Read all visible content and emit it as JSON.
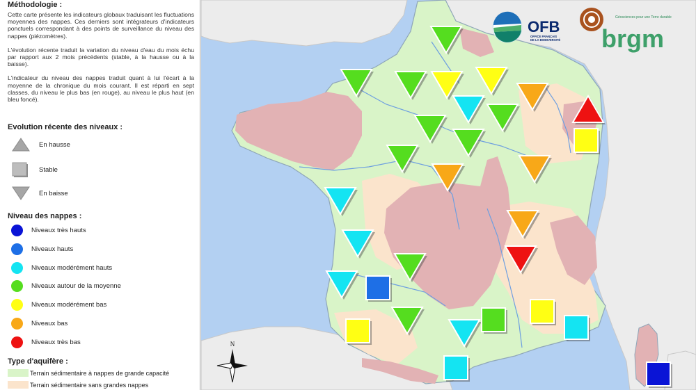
{
  "legend": {
    "methodology_title": "Méthodologie :",
    "methodology_p1": "Cette carte présente les indicateurs globaux traduisant les fluctuations moyennes des nappes. Ces derniers sont intégrateurs d'indicateurs ponctuels correspondant à des points de surveillance du niveau des nappes (piézomètres).",
    "methodology_p2": "L'évolution récente traduit la variation du niveau d'eau du mois échu par rapport aux 2 mois précédents (stable, à la hausse ou à la baisse).",
    "methodology_p3": "L'indicateur du niveau des nappes traduit quant à lui l'écart à la moyenne de la chronique du mois courant. Il est réparti en sept classes, du niveau le plus bas (en rouge), au niveau le plus haut (en bleu foncé).",
    "evolution_title": "Evolution récente des niveaux :",
    "evolution_items": [
      "En hausse",
      "Stable",
      "En baisse"
    ],
    "niveau_title": "Niveau des nappes :",
    "niveau_items": [
      {
        "label": "Niveaux très hauts",
        "color": "#0a14d6"
      },
      {
        "label": "Niveaux hauts",
        "color": "#1e6fe6"
      },
      {
        "label": "Niveaux modérément hauts",
        "color": "#14e4f2"
      },
      {
        "label": "Niveaux autour de la moyenne",
        "color": "#55dd1f"
      },
      {
        "label": "Niveaux modérément bas",
        "color": "#ffff14"
      },
      {
        "label": "Niveaux bas",
        "color": "#f8a818"
      },
      {
        "label": "Niveaux très bas",
        "color": "#ee1212"
      }
    ],
    "aquifere_title": "Type d'aquifère :",
    "aquifere_items": [
      {
        "label": "Terrain sédimentaire à nappes de grande capacité",
        "color": "#d9f4c8"
      },
      {
        "label": "Terrain sédimentaire sans grandes nappes",
        "color": "#fbe4cc"
      }
    ]
  },
  "logos": {
    "ofb": "OFB",
    "ofb_sub_1": "OFFICE FRANÇAIS",
    "ofb_sub_2": "DE LA BIODIVERSITÉ",
    "brgm": "brgm",
    "brgm_tagline": "Géosciences pour une Terre durable"
  },
  "compass_label": "N",
  "colors": {
    "sea": "#b3d0f2",
    "land_outside": "#ececec",
    "sedimentary": "#d9f4c8",
    "sedimentary_no_aquifer": "#fbe4cc",
    "basement": "#e2b2b4",
    "river": "#6e9fe0"
  },
  "indicators": [
    {
      "level": "moyenne",
      "trend": "baisse"
    },
    {
      "level": "moyenne",
      "trend": "baisse"
    },
    {
      "level": "moyenne",
      "trend": "baisse"
    },
    {
      "level": "modérément bas",
      "trend": "baisse"
    },
    {
      "level": "modérément bas",
      "trend": "baisse"
    },
    {
      "level": "bas",
      "trend": "baisse"
    },
    {
      "level": "très bas",
      "trend": "hausse"
    },
    {
      "level": "modérément bas",
      "trend": "stable"
    },
    {
      "level": "modérément hauts",
      "trend": "baisse"
    },
    {
      "level": "moyenne",
      "trend": "baisse"
    },
    {
      "level": "moyenne",
      "trend": "baisse"
    },
    {
      "level": "moyenne",
      "trend": "baisse"
    },
    {
      "level": "moyenne",
      "trend": "baisse"
    },
    {
      "level": "bas",
      "trend": "baisse"
    },
    {
      "level": "bas",
      "trend": "baisse"
    },
    {
      "level": "modérément hauts",
      "trend": "baisse"
    },
    {
      "level": "bas",
      "trend": "baisse"
    },
    {
      "level": "modérément hauts",
      "trend": "baisse"
    },
    {
      "level": "moyenne",
      "trend": "baisse"
    },
    {
      "level": "très bas",
      "trend": "baisse"
    },
    {
      "level": "modérément hauts",
      "trend": "baisse"
    },
    {
      "level": "hauts",
      "trend": "stable"
    },
    {
      "level": "moyenne",
      "trend": "baisse"
    },
    {
      "level": "modérément bas",
      "trend": "stable"
    },
    {
      "level": "modérément hauts",
      "trend": "baisse"
    },
    {
      "level": "moyenne",
      "trend": "stable"
    },
    {
      "level": "modérément bas",
      "trend": "stable"
    },
    {
      "level": "modérément hauts",
      "trend": "stable"
    },
    {
      "level": "modérément hauts",
      "trend": "stable"
    },
    {
      "level": "très hauts",
      "trend": "stable"
    }
  ]
}
